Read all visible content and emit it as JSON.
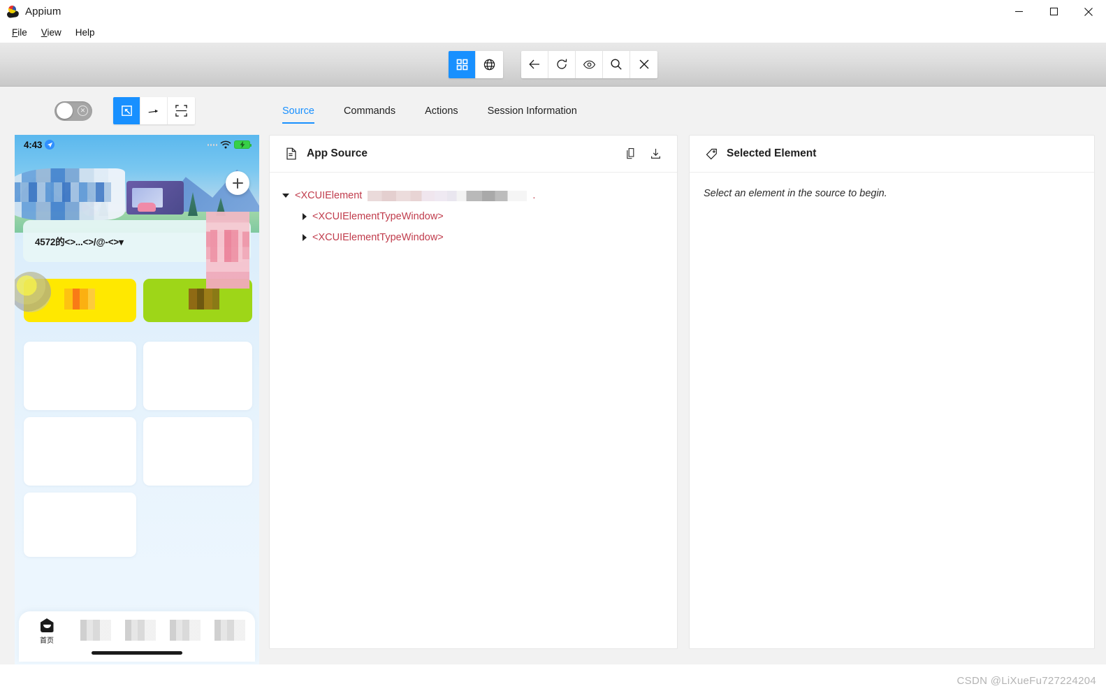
{
  "window": {
    "title": "Appium",
    "app_icon": "appium-logo-icon",
    "controls": [
      {
        "name": "minimize-button",
        "icon": "minimize-icon"
      },
      {
        "name": "maximize-button",
        "icon": "maximize-icon"
      },
      {
        "name": "close-button",
        "icon": "close-icon"
      }
    ]
  },
  "menubar": {
    "items": [
      {
        "label": "File",
        "mnemonic": "F"
      },
      {
        "label": "View",
        "mnemonic": "V"
      },
      {
        "label": "Help",
        "mnemonic": "H"
      }
    ]
  },
  "toolbar": {
    "left_group": [
      {
        "name": "app-mode-button",
        "icon": "grid-apps-icon",
        "active": true
      },
      {
        "name": "web-mode-button",
        "icon": "globe-icon",
        "active": false
      }
    ],
    "right_group": [
      {
        "name": "back-button",
        "icon": "arrow-left-icon"
      },
      {
        "name": "refresh-source-button",
        "icon": "refresh-icon"
      },
      {
        "name": "toggle-visibility-button",
        "icon": "eye-icon"
      },
      {
        "name": "search-element-button",
        "icon": "search-icon"
      },
      {
        "name": "quit-session-button",
        "icon": "close-x-icon"
      }
    ]
  },
  "inspector_controls": {
    "recorder_toggle": {
      "name": "recorder-toggle",
      "state": "off",
      "icon": "circle-x-icon"
    },
    "modes": [
      {
        "name": "select-mode-button",
        "icon": "select-cursor-icon",
        "active": true
      },
      {
        "name": "swipe-mode-button",
        "icon": "swipe-arrow-icon",
        "active": false
      },
      {
        "name": "tap-mode-button",
        "icon": "crop-frame-icon",
        "active": false
      }
    ]
  },
  "tabs": [
    {
      "label": "Source",
      "active": true
    },
    {
      "label": "Commands",
      "active": false
    },
    {
      "label": "Actions",
      "active": false
    },
    {
      "label": "Session Information",
      "active": false
    }
  ],
  "app_source": {
    "title": "App Source",
    "title_icon": "document-icon",
    "actions": [
      {
        "name": "copy-source-button",
        "icon": "copy-icon"
      },
      {
        "name": "download-source-button",
        "icon": "download-icon"
      }
    ],
    "tree": [
      {
        "label": "<XCUIElement",
        "redacted": true,
        "expanded": true,
        "level": 1,
        "tail": "."
      },
      {
        "label": "<XCUIElementTypeWindow>",
        "redacted": false,
        "expanded": false,
        "level": 2
      },
      {
        "label": "<XCUIElementTypeWindow>",
        "redacted": false,
        "expanded": false,
        "level": 2
      }
    ]
  },
  "selected_element": {
    "title": "Selected Element",
    "title_icon": "tag-icon",
    "hint": "Select an element in the source to begin."
  },
  "device_screen": {
    "status_bar": {
      "time": "4:43",
      "location_icon": "location-arrow-icon",
      "wifi_icon": "wifi-icon",
      "battery_icon": "battery-charging-icon"
    },
    "search_text": "4572的<>...<>/@-<>▾",
    "fab_icon": "plus-icon",
    "tab_bar": {
      "home_label": "首页",
      "home_icon": "home-icon"
    }
  },
  "watermark": "CSDN @LiXueFu727224204",
  "colors": {
    "accent": "#1890ff",
    "tree_text": "#c03c4c",
    "toolbar_bg": "#dedede",
    "panel_bg": "#ffffff",
    "body_bg": "#f2f2f2"
  }
}
